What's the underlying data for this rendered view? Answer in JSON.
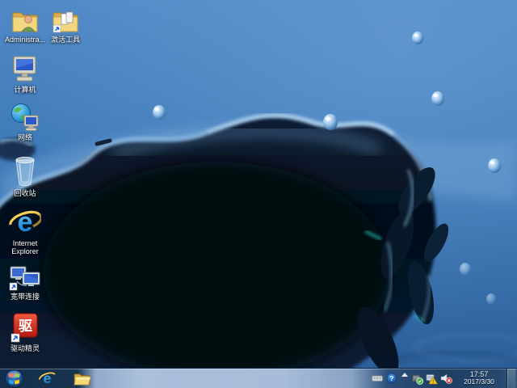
{
  "desktop": {
    "icons": [
      {
        "id": "administrator-folder",
        "label": "Administra..."
      },
      {
        "id": "activation-tools-folder",
        "label": "激活工具"
      },
      {
        "id": "computer",
        "label": "计算机"
      },
      {
        "id": "network",
        "label": "网络"
      },
      {
        "id": "recycle-bin",
        "label": "回收站"
      },
      {
        "id": "internet-explorer",
        "label": "Internet Explorer"
      },
      {
        "id": "broadband-connection",
        "label": "宽带连接"
      },
      {
        "id": "driver-genius",
        "label": "驱动精灵"
      }
    ]
  },
  "taskbar": {
    "tray": {
      "time": "17:57",
      "date": "2017/3/30"
    }
  },
  "icon_glyphs": {
    "ie_letter": "e",
    "ie_letter_small": "e",
    "driver_genius_char": "驱",
    "help_mark": "?",
    "warning_mark": "!"
  },
  "colors": {
    "wallpaper_top": "#5189c7",
    "wallpaper_bottom": "#2b5d97",
    "splash_dark": "#040e1a",
    "taskbar_dark": "#17334f",
    "taskbar_light": "#a9bfda"
  }
}
